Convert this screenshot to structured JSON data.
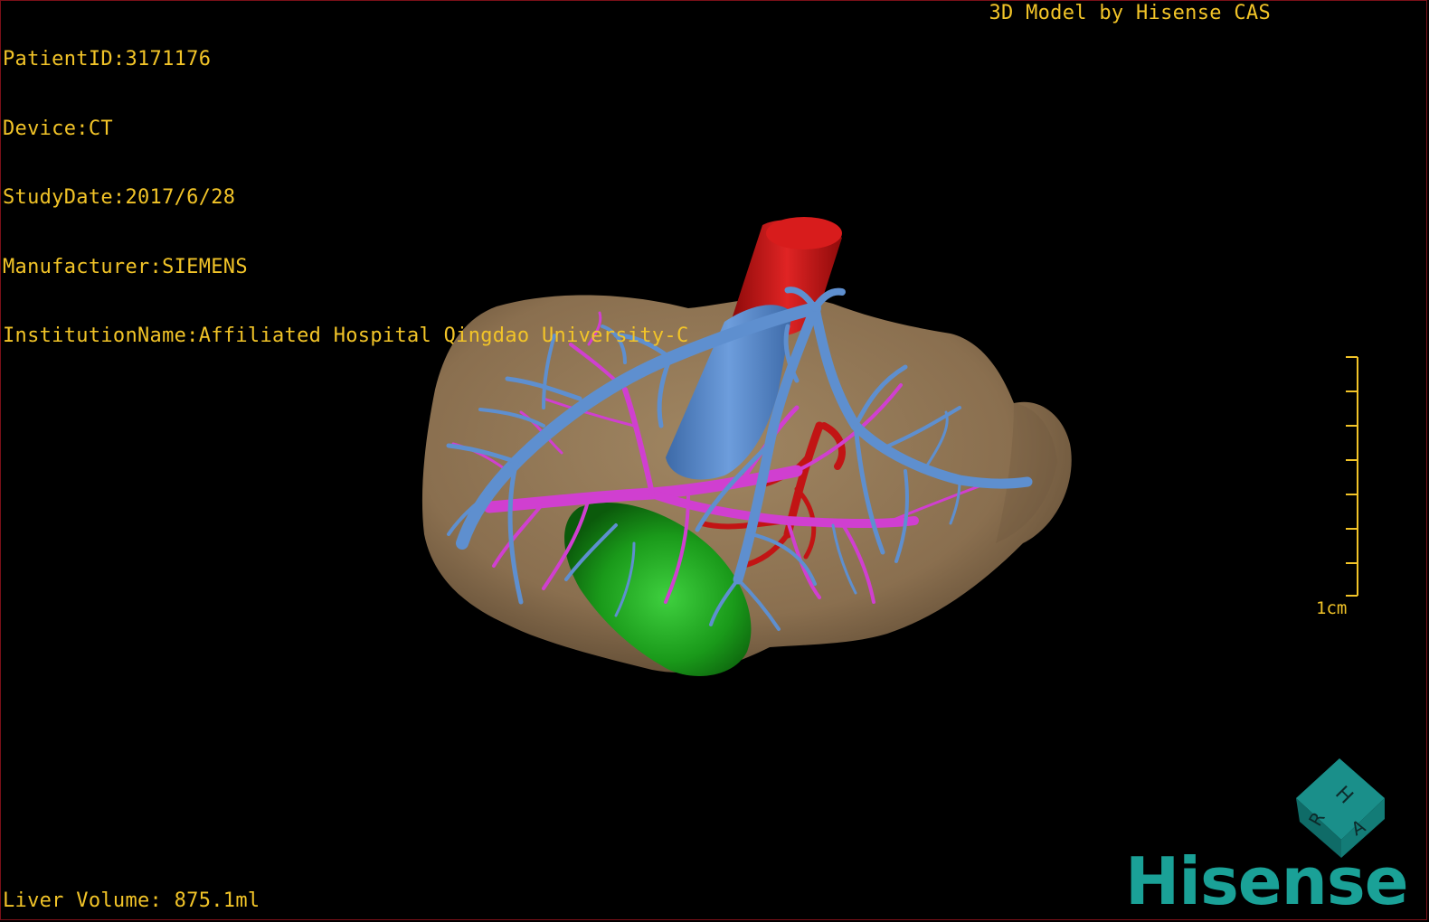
{
  "overlay": {
    "patient_id": "PatientID:3171176",
    "device": "Device:CT",
    "study_date": "StudyDate:2017/6/28",
    "manufacturer": "Manufacturer:SIEMENS",
    "institution": "InstitutionName:Affiliated Hospital Qingdao University-C"
  },
  "credit": "3D Model by Hisense CAS",
  "liver_volume": "Liver Volume: 875.1ml",
  "scale_bar": {
    "label": "1cm"
  },
  "orientation_cube": {
    "faces": [
      "H",
      "R",
      "A"
    ]
  },
  "brand": "Hisense",
  "colors": {
    "overlay_text": "#f2c428",
    "liver": "#8c7150",
    "hepatic_vein": "#5e8fcf",
    "portal_vein": "#d23fd2",
    "artery": "#c41010",
    "gallbladder": "#1f9c1f",
    "brand": "#1aa197",
    "border": "#7a1018"
  }
}
